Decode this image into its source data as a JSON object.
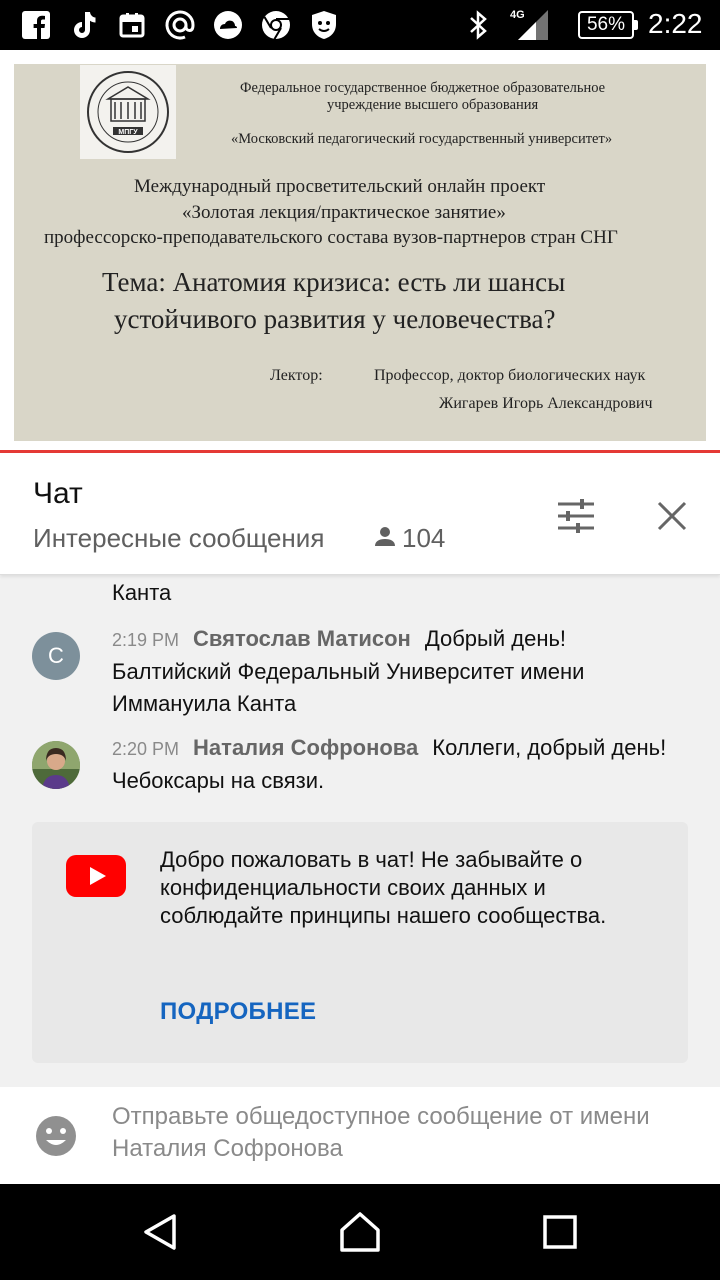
{
  "status_bar": {
    "time": "2:22",
    "battery": "56%",
    "network": "4G",
    "left_icons": [
      "facebook-icon",
      "tiktok-icon",
      "calendar-icon",
      "at-sign-icon",
      "cloud-icon",
      "chrome-icon",
      "shield-icon"
    ],
    "right_icons": [
      "bluetooth-icon",
      "signal-icon"
    ]
  },
  "video": {
    "slide": {
      "logo_text": "МПГУ",
      "org_line1": "Федеральное государственное бюджетное образовательное",
      "org_line2": "учреждение высшего образования",
      "org_line3": "«Московский педагогический государственный университет»",
      "project_line1": "Международный просветительский онлайн проект",
      "project_line2": "«Золотая лекция/практическое занятие»",
      "project_line3": "профессорско-преподавательского состава вузов-партнеров стран СНГ",
      "topic_line1": "Тема: Анатомия кризиса: есть ли шансы",
      "topic_line2": "устойчивого развития у человечества?",
      "lecturer_label": "Лектор:",
      "lecturer_title": "Профессор, доктор биологических наук",
      "lecturer_name": "Жигарев Игорь Александрович"
    }
  },
  "chat": {
    "title": "Чат",
    "mode": "Интересные сообщения",
    "viewers": "104",
    "colors": {
      "link": "#1565c0",
      "accent": "#e53935"
    },
    "prev_fragment": "Канта",
    "messages": [
      {
        "avatar_letter": "С",
        "avatar_color": "#7d909b",
        "time": "2:19 PM",
        "author": "Святослав Матисон",
        "text": "Добрый день! Балтийский Федеральный Университет имени Иммануила Канта"
      },
      {
        "avatar_letter": "",
        "avatar_color": "#6d8a5a",
        "time": "2:20 PM",
        "author": "Наталия Софронова",
        "text": "Коллеги, добрый день! Чебоксары на связи."
      }
    ],
    "welcome": {
      "text": "Добро пожаловать в чат! Не забывайте о конфиденциальности своих данных и соблюдайте принципы нашего сообщества.",
      "link": "ПОДРОБНЕЕ"
    },
    "input": {
      "placeholder": "Отправьте общедоступное сообщение от имени Наталия Софронова"
    }
  },
  "nav": {
    "back": "back-icon",
    "home": "home-icon",
    "recents": "recents-icon"
  }
}
